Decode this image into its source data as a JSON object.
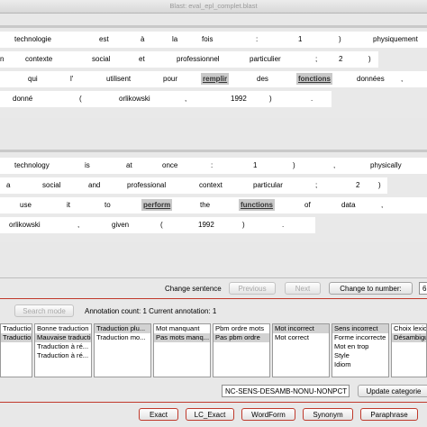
{
  "window": {
    "title": "Blast: eval_epl_complet.blast"
  },
  "source": {
    "line1": [
      "technologie",
      "est",
      "à",
      "la",
      "fois",
      ":",
      "1",
      ")",
      "physiquement"
    ],
    "line2": [
      "n",
      "contexte",
      "social",
      "et",
      "professionnel",
      "particulier",
      ";",
      "2",
      ")"
    ],
    "line3": [
      "qui",
      "l'",
      "utilisent",
      "pour",
      "remplir",
      "des",
      "fonctions",
      "données",
      ","
    ],
    "line4": [
      "donné",
      "(",
      "orlikowski",
      ",",
      "1992",
      ")",
      "."
    ]
  },
  "target": {
    "line1": [
      "technology",
      "is",
      "at",
      "once",
      ":",
      "1",
      ")",
      ",",
      "physically"
    ],
    "line2": [
      "a",
      "social",
      "and",
      "professional",
      "context",
      "particular",
      ";",
      "2",
      ")"
    ],
    "line3": [
      "use",
      "it",
      "to",
      "perform",
      "the",
      "functions",
      "of",
      "data",
      ","
    ],
    "line4": [
      "orlikowski",
      ",",
      "given",
      "(",
      "1992",
      ")",
      "."
    ]
  },
  "sentence_controls": {
    "change_sentence_label": "Change sentence",
    "previous_label": "Previous",
    "next_label": "Next",
    "change_to_number_label": "Change to number:",
    "number_value": "6"
  },
  "annotation_bar": {
    "search_mode_label": "Search mode",
    "annotation_status": "Annotation count: 1 Current annotation: 1"
  },
  "category_lists": [
    [
      "Traduction atte",
      "Traduction non..."
    ],
    [
      "Bonne traduction",
      "Mauvaise traduction",
      "Traduction à ré...",
      "Traduction à ré..."
    ],
    [
      "Traduction plu...",
      "Traduction mo..."
    ],
    [
      "Mot manquant",
      "Pas mots manq..."
    ],
    [
      "Pbm ordre mots",
      "Pas pbm ordre"
    ],
    [
      "Mot incorrect",
      "Mot correct"
    ],
    [
      "Sens incorrect",
      "Forme incorrecte",
      "Mot en trop",
      "Style",
      "Idiom"
    ],
    [
      "Choix lexicaux",
      "Désambiguïs..."
    ]
  ],
  "selected_items": [
    [
      1
    ],
    [
      1
    ],
    [
      0
    ],
    [
      1
    ],
    [
      1
    ],
    [
      0
    ],
    [
      0
    ],
    [
      1
    ]
  ],
  "category_code": {
    "value": "NC-SENS-DESAMB-NONU-NONPCT",
    "update_label": "Update categorie"
  },
  "bottom_buttons": [
    "Exact",
    "LC_Exact",
    "WordForm",
    "Synonym",
    "Paraphrase"
  ]
}
